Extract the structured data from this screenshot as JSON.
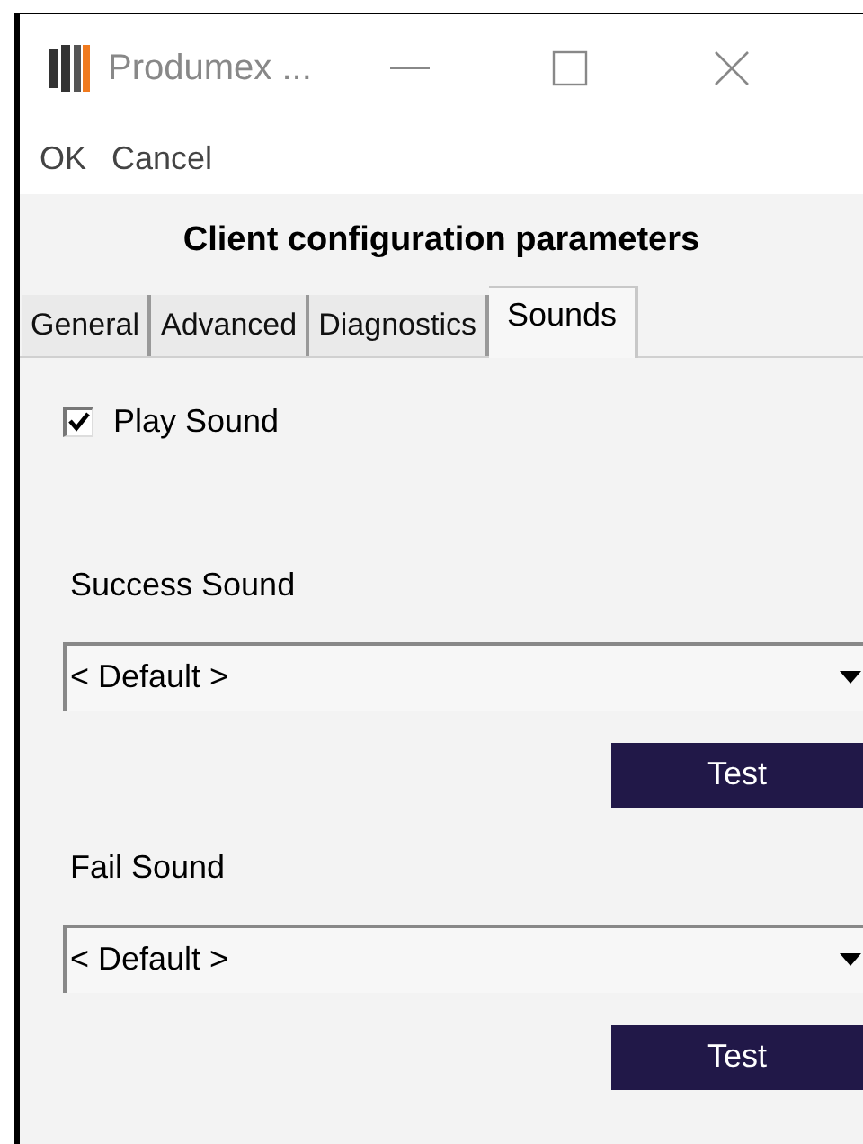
{
  "window": {
    "title": "Produmex ..."
  },
  "menu": [
    "OK",
    "Cancel"
  ],
  "heading": "Client configuration parameters",
  "tabs": [
    {
      "label": "General",
      "selected": false
    },
    {
      "label": "Advanced",
      "selected": false
    },
    {
      "label": "Diagnostics",
      "selected": false
    },
    {
      "label": "Sounds",
      "selected": true
    }
  ],
  "play_sound": {
    "label": "Play Sound",
    "checked": true
  },
  "sounds": [
    {
      "label": "Success Sound",
      "value": "< Default >",
      "button": "Test"
    },
    {
      "label": "Fail Sound",
      "value": "< Default >",
      "button": "Test"
    }
  ]
}
